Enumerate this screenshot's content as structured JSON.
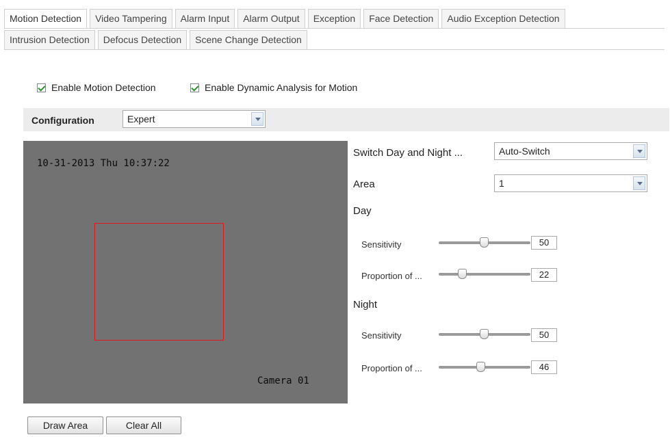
{
  "tabs_row1": [
    {
      "label": "Motion Detection",
      "active": true
    },
    {
      "label": "Video Tampering",
      "active": false
    },
    {
      "label": "Alarm Input",
      "active": false
    },
    {
      "label": "Alarm Output",
      "active": false
    },
    {
      "label": "Exception",
      "active": false
    },
    {
      "label": "Face Detection",
      "active": false
    },
    {
      "label": "Audio Exception Detection",
      "active": false
    }
  ],
  "tabs_row2": [
    {
      "label": "Intrusion Detection",
      "active": false
    },
    {
      "label": "Defocus Detection",
      "active": false
    },
    {
      "label": "Scene Change Detection",
      "active": false
    }
  ],
  "checkboxes": {
    "enable_motion": {
      "label": "Enable Motion Detection",
      "checked": true
    },
    "enable_dynamic": {
      "label": "Enable Dynamic Analysis for Motion",
      "checked": true
    }
  },
  "config": {
    "label": "Configuration",
    "value": "Expert"
  },
  "video": {
    "timestamp": "10-31-2013 Thu 10:37:22",
    "camera_name": "Camera 01"
  },
  "right_panel": {
    "switch_label": "Switch Day and Night ...",
    "switch_value": "Auto-Switch",
    "area_label": "Area",
    "area_value": "1",
    "day": {
      "title": "Day",
      "sensitivity": {
        "label": "Sensitivity",
        "value": "50",
        "level": 50
      },
      "proportion": {
        "label": "Proportion of ...",
        "value": "22",
        "level": 22
      }
    },
    "night": {
      "title": "Night",
      "sensitivity": {
        "label": "Sensitivity",
        "value": "50",
        "level": 50
      },
      "proportion": {
        "label": "Proportion of ...",
        "value": "46",
        "level": 46
      }
    }
  },
  "buttons": {
    "draw_area": "Draw Area",
    "clear_all": "Clear All"
  },
  "colors": {
    "area_outline": "#e01818",
    "checkmark": "#2f8f2f",
    "config_bar": "#ececec",
    "video_bg": "#727272"
  }
}
